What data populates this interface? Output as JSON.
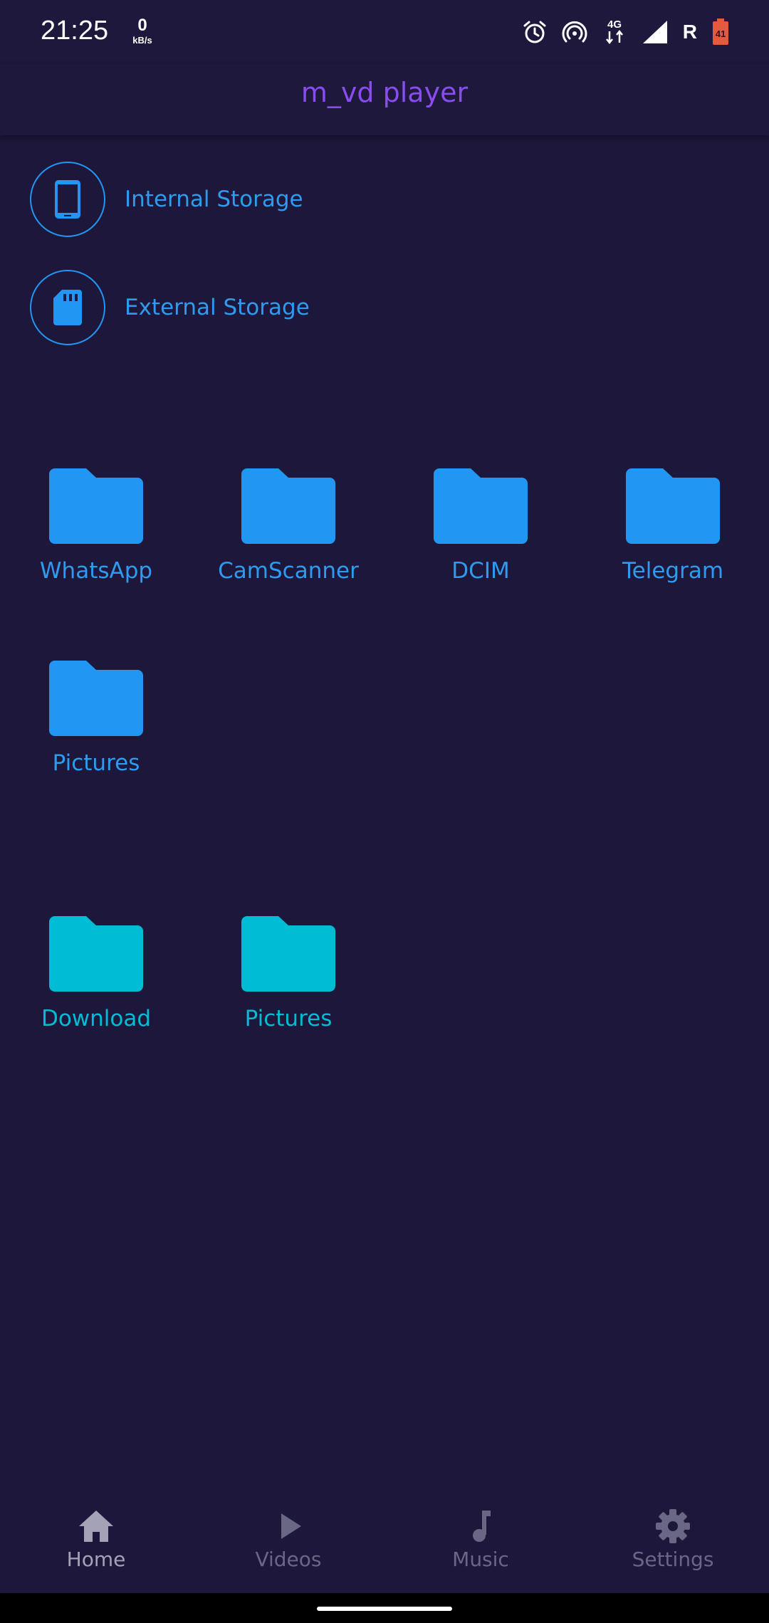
{
  "status_bar": {
    "time": "21:25",
    "speed_value": "0",
    "speed_unit": "kB/s",
    "network": "4G",
    "roaming": "R",
    "battery_level": "41"
  },
  "app_bar": {
    "title": "m_vd player"
  },
  "storage": [
    {
      "label": "Internal Storage",
      "icon": "phone-icon"
    },
    {
      "label": "External Storage",
      "icon": "sd-card-icon"
    }
  ],
  "folders_blue": [
    {
      "label": "WhatsApp"
    },
    {
      "label": "CamScanner"
    },
    {
      "label": "DCIM"
    },
    {
      "label": "Telegram"
    },
    {
      "label": "Pictures"
    }
  ],
  "folders_cyan": [
    {
      "label": "Download"
    },
    {
      "label": "Pictures"
    }
  ],
  "bottom_nav": {
    "items": [
      {
        "label": "Home",
        "icon": "home-icon",
        "active": true
      },
      {
        "label": "Videos",
        "icon": "play-icon",
        "active": false
      },
      {
        "label": "Music",
        "icon": "music-note-icon",
        "active": false
      },
      {
        "label": "Settings",
        "icon": "gear-icon",
        "active": false
      }
    ]
  },
  "colors": {
    "background": "#1c173b",
    "title": "#8a4cf0",
    "accent_blue": "#2196f3",
    "accent_cyan": "#00bcd4",
    "nav_active": "#a4a2b6",
    "nav_inactive": "#6a6785"
  }
}
